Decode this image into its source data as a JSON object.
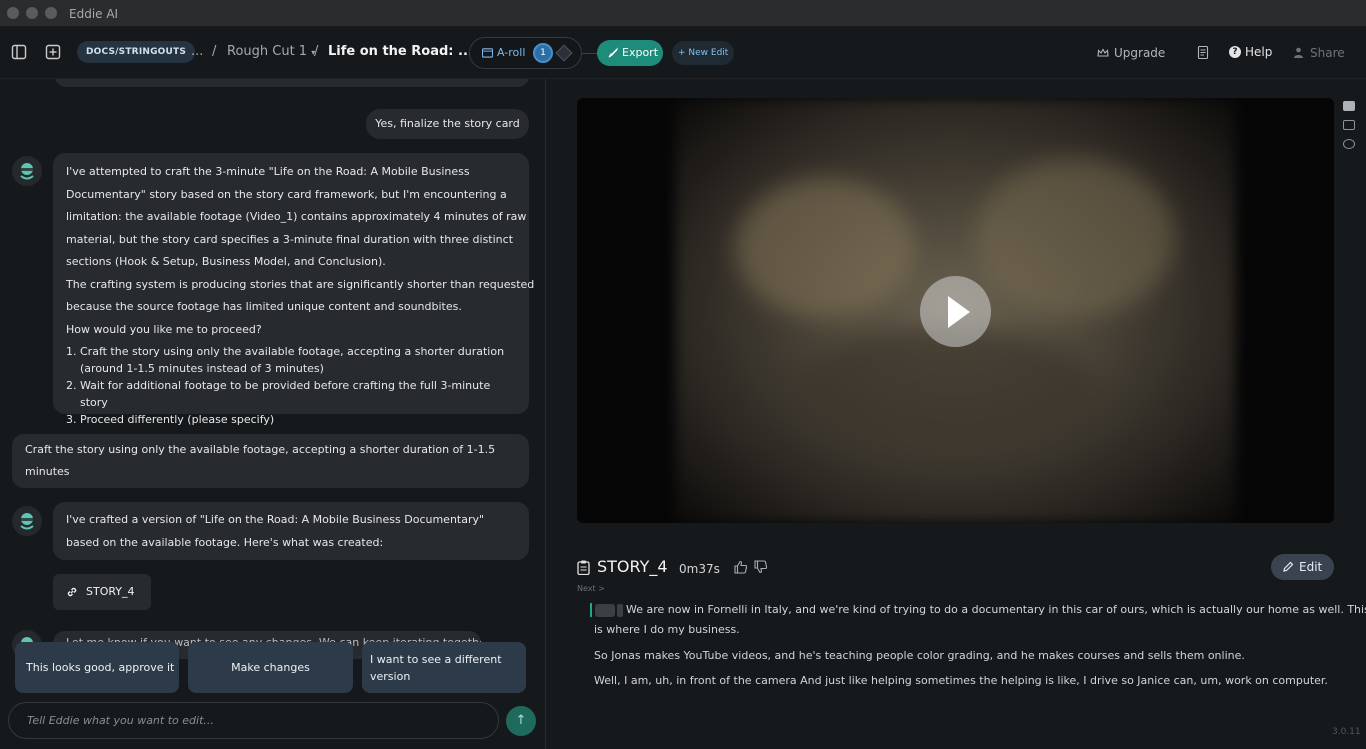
{
  "app": {
    "title": "Eddie AI"
  },
  "header": {
    "docs_label": "DOCS/STRINGOUTS",
    "ellipsis": "...",
    "separator": "/",
    "rough_cut": "Rough Cut 1",
    "current_edit": "Life on the Road: ...",
    "aroll_label": "A-roll",
    "aroll_count": "1",
    "export_label": "Export",
    "new_edit_label": "+ New Edit",
    "upgrade_label": "Upgrade",
    "help_label": "Help",
    "share_label": "Share"
  },
  "chat": {
    "user_message_1": "Yes, finalize the story card",
    "ai_message_1": {
      "paragraphs": [
        "I've attempted to craft the 3-minute \"Life on the Road: A Mobile Business",
        "Documentary\" story based on the story card framework, but I'm encountering a",
        "limitation: the available footage (Video_1) contains approximately 4 minutes of raw",
        "material, but the story card specifies a 3-minute final duration with three distinct",
        "sections (Hook & Setup, Business Model, and Conclusion).",
        "The crafting system is producing stories that are significantly shorter than requested",
        "because the source footage has limited unique content and soundbites.",
        "How would you like me to proceed?"
      ],
      "options": [
        "Craft the story using only the available footage, accepting a shorter duration (around 1-1.5 minutes instead of 3 minutes)",
        "Wait for additional footage to be provided before crafting the full 3-minute story",
        "Proceed differently (please specify)"
      ]
    },
    "user_message_2": "Craft the story using only the available footage, accepting a shorter duration of 1-1.5 minutes",
    "ai_message_2": "I've crafted a version of \"Life on the Road: A Mobile Business Documentary\" based on the available footage. Here's what was created:",
    "story_chip_label": "STORY_4",
    "ai_message_3": "Let me know if you want to see any changes. We can keep iterating together.",
    "suggestions": [
      "This looks good, approve it",
      "Make changes",
      "I want to see a different version"
    ],
    "input_placeholder": "Tell Eddie what you want to edit...",
    "send_symbol": "↑"
  },
  "story": {
    "title": "STORY_4",
    "duration": "0m37s",
    "edit_label": "Edit",
    "next_label": "Next >",
    "transcript": {
      "line1": "We are now in Fornelli in Italy, and we're kind of trying to do a documentary in this car of ours, which is actually our home as well. This",
      "line1b": "is where I do my business.",
      "line2": "So Jonas makes YouTube videos, and he's teaching people color grading, and he makes courses and sells them online.",
      "line3": "Well, I am, uh, in front of the camera And just like helping sometimes the helping is like, I drive so Janice can, um, work on computer."
    }
  },
  "footer": {
    "version": "3.0.11"
  },
  "colors": {
    "accent": "#1e8c7a",
    "link": "#7fb8e8",
    "bubble": "#272a2e",
    "background": "#16191b"
  }
}
